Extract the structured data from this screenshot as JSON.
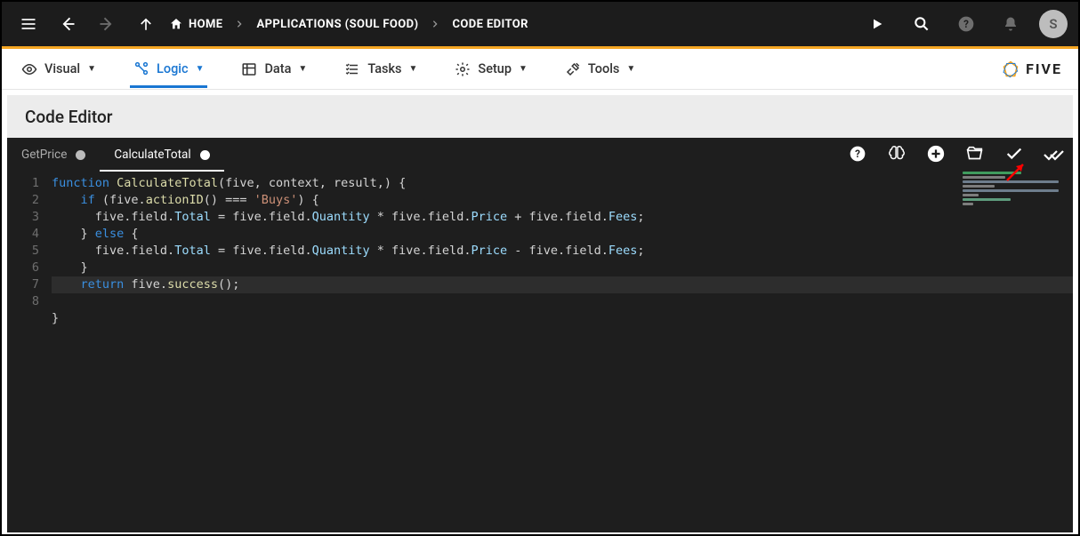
{
  "topbar": {
    "home_label": "HOME",
    "breadcrumb_app": "APPLICATIONS (SOUL FOOD)",
    "breadcrumb_page": "CODE EDITOR",
    "avatar_initial": "S"
  },
  "tabs": {
    "visual": "Visual",
    "logic": "Logic",
    "data": "Data",
    "tasks": "Tasks",
    "setup": "Setup",
    "tools": "Tools",
    "logo": "FIVE"
  },
  "panel": {
    "title": "Code Editor"
  },
  "file_tabs": [
    {
      "label": "GetPrice",
      "active": false
    },
    {
      "label": "CalculateTotal",
      "active": true
    }
  ],
  "code": {
    "lines": [
      1,
      2,
      3,
      4,
      5,
      6,
      7,
      8
    ],
    "l1_kw": "function",
    "l1_fn": "CalculateTotal",
    "l1_params": "(five, context, result,)",
    "l1_brace": " {",
    "l2_if": "if",
    "l2_cond_a": " (five.",
    "l2_fn": "actionID",
    "l2_cond_b": "() === ",
    "l2_str": "'Buys'",
    "l2_cond_c": ") {",
    "l3_a": "five.field.",
    "l3_total": "Total",
    "l3_b": " = five.field.",
    "l3_qty": "Quantity",
    "l3_c": " * five.field.",
    "l3_price": "Price",
    "l3_d": " + five.field.",
    "l3_fees": "Fees",
    "l3_e": ";",
    "l4_a": "} ",
    "l4_else": "else",
    "l4_b": " {",
    "l5_a": "five.field.",
    "l5_total": "Total",
    "l5_b": " = five.field.",
    "l5_qty": "Quantity",
    "l5_c": " * five.field.",
    "l5_price": "Price",
    "l5_d": " - five.field.",
    "l5_fees": "Fees",
    "l5_e": ";",
    "l6": "}",
    "l7_ret": "return",
    "l7_a": " five.",
    "l7_fn": "success",
    "l7_b": "();",
    "l8": "}"
  }
}
